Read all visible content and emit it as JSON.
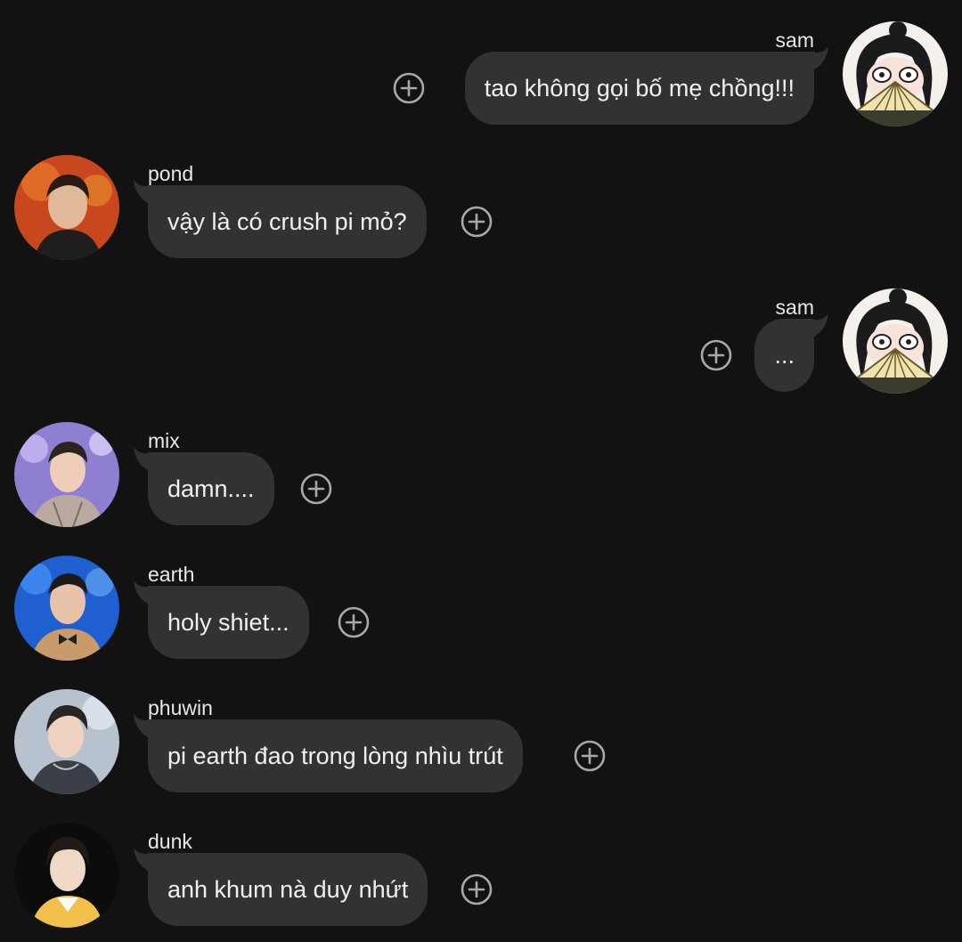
{
  "messages": [
    {
      "side": "right",
      "sender": "sam",
      "text": "tao không gọi bố mẹ chồng!!!",
      "avatar": "sam-avatar"
    },
    {
      "side": "left",
      "sender": "pond",
      "text": "vậy là có crush pi mỏ?",
      "avatar": "pond-avatar"
    },
    {
      "side": "right",
      "sender": "sam",
      "text": "...",
      "avatar": "sam-avatar"
    },
    {
      "side": "left",
      "sender": "mix",
      "text": "damn....",
      "avatar": "mix-avatar"
    },
    {
      "side": "left",
      "sender": "earth",
      "text": "holy shiet...",
      "avatar": "earth-avatar"
    },
    {
      "side": "left",
      "sender": "phuwin",
      "text": "pi earth đao trong lòng nhìu trút",
      "avatar": "phuwin-avatar"
    },
    {
      "side": "left",
      "sender": "dunk",
      "text": "anh khum nà duy nhứt",
      "avatar": "dunk-avatar"
    }
  ],
  "icons": {
    "add_reaction": "plus-circle-icon"
  },
  "colors": {
    "background": "#121212",
    "bubble": "#323232",
    "text": "#f0f0f0",
    "icon": "#a8a8a8"
  }
}
